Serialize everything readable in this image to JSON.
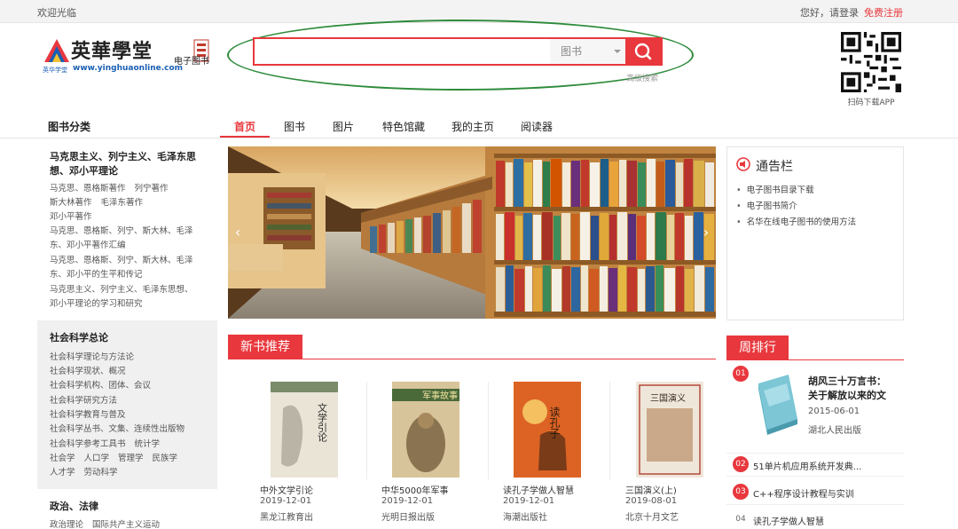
{
  "topbar": {
    "welcome": "欢迎光临",
    "greeting": "您好，",
    "login": "请登录",
    "register": "免费注册"
  },
  "logo": {
    "brand": "英華學堂",
    "url": "www.yinghuaonline.com",
    "sub": "英华学堂",
    "kind": "电子图书"
  },
  "search": {
    "placeholder": "",
    "category": "图书",
    "advanced": "高级搜索"
  },
  "qr": {
    "label": "扫码下载APP"
  },
  "nav": {
    "category_title": "图书分类",
    "tabs": [
      "首页",
      "图书",
      "图片",
      "特色馆藏",
      "我的主页",
      "阅读器"
    ]
  },
  "sidebar": {
    "marx": {
      "title": "马克思主义、列宁主义、毛泽东思想、邓小平理论",
      "lines": [
        [
          "马克思、恩格斯著作",
          "列宁著作"
        ],
        [
          "斯大林著作",
          "毛泽东著作"
        ],
        [
          "邓小平著作"
        ],
        [
          "马克思、恩格斯、列宁、斯大林、毛泽"
        ],
        [
          "东、邓小平著作汇编"
        ],
        [
          "马克思、恩格斯、列宁、斯大林、毛泽"
        ],
        [
          "东、邓小平的生平和传记"
        ],
        [
          "马克思主义、列宁主义、毛泽东思想、"
        ],
        [
          "邓小平理论的学习和研究"
        ]
      ]
    },
    "social": {
      "title": "社会科学总论",
      "lines": [
        [
          "社会科学理论与方法论"
        ],
        [
          "社会科学现状、概况"
        ],
        [
          "社会科学机构、团体、会议"
        ],
        [
          "社会科学研究方法"
        ],
        [
          "社会科学教育与普及"
        ],
        [
          "社会科学丛书、文集、连续性出版物"
        ],
        [
          "社会科学参考工具书",
          "统计学"
        ],
        [
          "社会学",
          "人口学",
          "管理学",
          "民族学"
        ],
        [
          "人才学",
          "劳动科学"
        ]
      ]
    },
    "politics": {
      "title": "政治、法律",
      "lines": [
        [
          "政治理论",
          "国际共产主义运动"
        ]
      ]
    }
  },
  "notice": {
    "title": "通告栏",
    "items": [
      "电子图书目录下载",
      "电子图书简介",
      "名华在线电子图书的使用方法"
    ]
  },
  "new_books": {
    "title": "新书推荐",
    "items": [
      {
        "title": "中外文学引论",
        "date": "2019-12-01",
        "publisher": "黑龙江教育出",
        "cover_text": "文学引论"
      },
      {
        "title": "中华5000年军事",
        "date": "2019-12-01",
        "publisher": "光明日报出版",
        "cover_text": "军事故事"
      },
      {
        "title": "读孔子学做人智慧",
        "date": "2019-12-01",
        "publisher": "海潮出版社",
        "cover_text": "读孔子"
      },
      {
        "title": "三国演义(上)",
        "date": "2019-08-01",
        "publisher": "北京十月文艺",
        "cover_text": "三国演义"
      }
    ]
  },
  "weekly": {
    "title": "周排行",
    "featured": {
      "rank": "01",
      "title_line1": "胡风三十万言书：",
      "title_line2": "关于解放以来的文",
      "date": "2015-06-01",
      "publisher": "湖北人民出版"
    },
    "items": [
      {
        "rank": "02",
        "title": "51单片机应用系统开发典..."
      },
      {
        "rank": "03",
        "title": "C++程序设计教程与实训"
      },
      {
        "rank": "04",
        "title": "读孔子学做人智慧"
      }
    ]
  },
  "colors": {
    "accent": "#e8383d",
    "ellipse": "#2e8b3a"
  }
}
